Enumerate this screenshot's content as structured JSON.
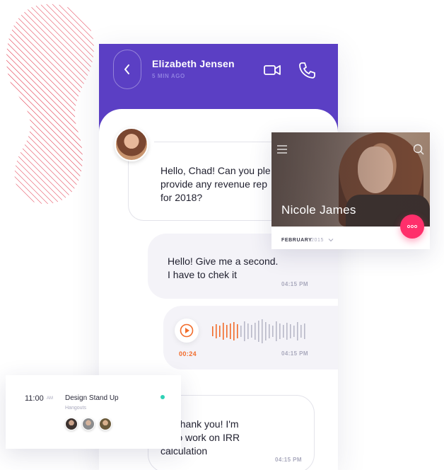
{
  "chat": {
    "contact_name": "Elizabeth Jensen",
    "contact_status": "5 MIN AGO",
    "messages": [
      {
        "text": "Hello, Chad! Can you ple\nprovide any revenue rep\nfor 2018?",
        "direction": "incoming"
      },
      {
        "text": "Hello! Give me a second.\nI have to chek it",
        "direction": "outgoing",
        "time": "04:15 PM"
      },
      {
        "type": "audio",
        "direction": "outgoing",
        "duration": "00:24",
        "time": "04:15 PM"
      },
      {
        "text": "at! Thank you! I'm\nng to work on IRR\ncalculation",
        "direction": "incoming",
        "time": "04:15 PM"
      }
    ]
  },
  "profile_card": {
    "name": "Nicole James",
    "month": "FEBRUARY",
    "year": "2015",
    "icons": [
      "menu-icon",
      "search-icon",
      "more-icon",
      "chevron-down-icon"
    ]
  },
  "calendar_card": {
    "time": "11:00",
    "ampm": "AM",
    "title": "Design Stand Up",
    "subtitle": "Hangouts"
  },
  "colors": {
    "header": "#5b3fc4",
    "accent_audio": "#f26b2a",
    "fab": "#ff2f6b",
    "status_dot": "#2fd1b5",
    "blob_stripes": "#e0263c"
  },
  "icons": [
    "back-arrow-icon",
    "video-call-icon",
    "phone-call-icon",
    "play-icon"
  ]
}
